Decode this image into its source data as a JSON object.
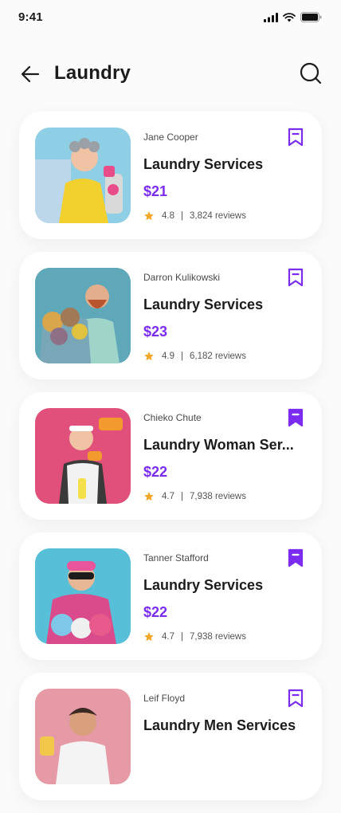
{
  "status_bar": {
    "time": "9:41"
  },
  "header": {
    "title": "Laundry"
  },
  "colors": {
    "accent": "#7b2cf0",
    "star": "#f5a623"
  },
  "icons": {
    "back": "arrow-left-icon",
    "search": "search-icon",
    "bookmark": "bookmark-icon",
    "star": "star-icon"
  },
  "services": [
    {
      "provider": "Jane Cooper",
      "title": "Laundry Services",
      "price": "$21",
      "rating": "4.8",
      "reviews": "3,824 reviews",
      "bookmarked": false
    },
    {
      "provider": "Darron Kulikowski",
      "title": "Laundry Services",
      "price": "$23",
      "rating": "4.9",
      "reviews": "6,182 reviews",
      "bookmarked": false
    },
    {
      "provider": "Chieko Chute",
      "title": "Laundry Woman Ser...",
      "price": "$22",
      "rating": "4.7",
      "reviews": "7,938 reviews",
      "bookmarked": true
    },
    {
      "provider": "Tanner Stafford",
      "title": "Laundry Services",
      "price": "$22",
      "rating": "4.7",
      "reviews": "7,938 reviews",
      "bookmarked": true
    },
    {
      "provider": "Leif Floyd",
      "title": "Laundry Men Services",
      "price": "",
      "rating": "",
      "reviews": "",
      "bookmarked": false
    }
  ]
}
